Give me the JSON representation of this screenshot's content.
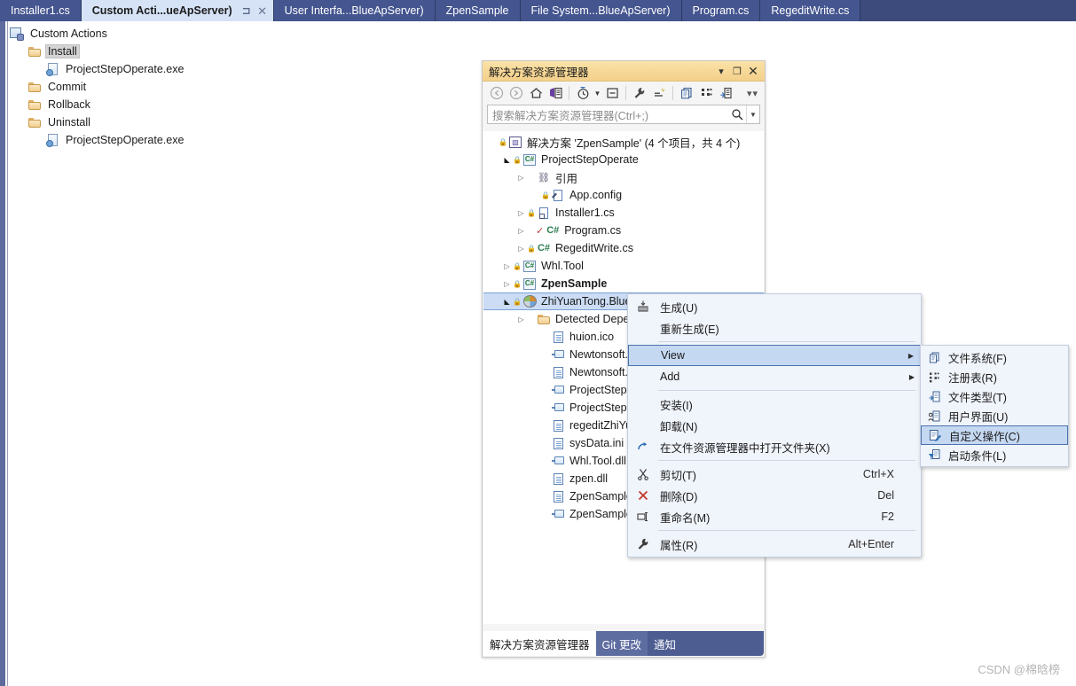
{
  "tabs": [
    {
      "label": "Installer1.cs",
      "active": false
    },
    {
      "label": "Custom Acti...ueApServer)",
      "active": true
    },
    {
      "label": "User Interfa...BlueApServer)",
      "active": false
    },
    {
      "label": "ZpenSample",
      "active": false
    },
    {
      "label": "File System...BlueApServer)",
      "active": false
    },
    {
      "label": "Program.cs",
      "active": false
    },
    {
      "label": "RegeditWrite.cs",
      "active": false
    }
  ],
  "tab_icons": {
    "pin": "pin-icon",
    "close": "close-icon"
  },
  "designer": {
    "tree": [
      {
        "label": "Custom Actions",
        "indent": 0,
        "icon": "custom-actions-icon",
        "selected": false
      },
      {
        "label": "Install",
        "indent": 1,
        "icon": "folder-icon",
        "selected": true
      },
      {
        "label": "ProjectStepOperate.exe",
        "indent": 2,
        "icon": "exe-icon",
        "selected": false
      },
      {
        "label": "Commit",
        "indent": 1,
        "icon": "folder-icon",
        "selected": false
      },
      {
        "label": "Rollback",
        "indent": 1,
        "icon": "folder-icon",
        "selected": false
      },
      {
        "label": "Uninstall",
        "indent": 1,
        "icon": "folder-icon",
        "selected": false
      },
      {
        "label": "ProjectStepOperate.exe",
        "indent": 2,
        "icon": "exe-icon",
        "selected": false
      }
    ]
  },
  "solution_explorer": {
    "title": "解决方案资源管理器",
    "window_buttons": {
      "dropdown": "▾",
      "maximize": "❐",
      "close": "✕"
    },
    "toolbar": [
      {
        "name": "back-icon"
      },
      {
        "name": "forward-icon"
      },
      {
        "name": "home-icon"
      },
      {
        "name": "sync-with-active-document-icon"
      },
      {
        "name": "pending-changes-filter-icon"
      },
      {
        "name": "filter-dropdown-icon"
      },
      {
        "name": "collapse-all-icon"
      },
      {
        "name": "properties-icon"
      },
      {
        "name": "show-all-files-icon"
      },
      {
        "name": "preview-selected-items-icon"
      },
      {
        "name": "view-class-diagram-icon"
      },
      {
        "name": "refresh-icon"
      }
    ],
    "overflow_label": "▾▾",
    "search_placeholder": "搜索解决方案资源管理器(Ctrl+;)",
    "tree": [
      {
        "label": "解决方案 'ZpenSample' (4 个项目，共 4 个)",
        "indent": 0,
        "chevron": "",
        "lock": true,
        "icon": "solution-icon",
        "bold": false,
        "selected": false
      },
      {
        "label": "ProjectStepOperate",
        "indent": 1,
        "chevron": "down",
        "lock": true,
        "icon": "csharp-project-icon",
        "bold": false,
        "selected": false
      },
      {
        "label": "引用",
        "indent": 2,
        "chevron": "right",
        "lock": false,
        "icon": "references-icon",
        "bold": false,
        "selected": false
      },
      {
        "label": "App.config",
        "indent": 3,
        "chevron": "",
        "lock": true,
        "icon": "config-file-icon",
        "bold": false,
        "selected": false
      },
      {
        "label": "Installer1.cs",
        "indent": 2,
        "chevron": "right",
        "lock": true,
        "icon": "installer-class-icon",
        "bold": false,
        "selected": false
      },
      {
        "label": "Program.cs",
        "indent": 2,
        "chevron": "right",
        "lock": false,
        "icon": "csharp-file-checked-icon",
        "bold": false,
        "selected": false
      },
      {
        "label": "RegeditWrite.cs",
        "indent": 2,
        "chevron": "right",
        "lock": true,
        "icon": "csharp-file-icon",
        "bold": false,
        "selected": false
      },
      {
        "label": "Whl.Tool",
        "indent": 1,
        "chevron": "right",
        "lock": true,
        "icon": "csharp-project-icon",
        "bold": false,
        "selected": false
      },
      {
        "label": "ZpenSample",
        "indent": 1,
        "chevron": "right",
        "lock": true,
        "icon": "csharp-project-icon",
        "bold": true,
        "selected": false
      },
      {
        "label": "ZhiYuanTong.BlueApServer",
        "indent": 1,
        "chevron": "down",
        "lock": true,
        "icon": "setup-project-icon",
        "bold": false,
        "selected": true
      },
      {
        "label": "Detected Dependencies",
        "indent": 2,
        "chevron": "right",
        "lock": false,
        "icon": "folder-icon",
        "bold": false,
        "selected": false
      },
      {
        "label": "huion.ico",
        "indent": 3,
        "chevron": "",
        "lock": false,
        "icon": "document-icon",
        "bold": false,
        "selected": false
      },
      {
        "label": "Newtonsoft.Json.dll",
        "indent": 3,
        "chevron": "",
        "lock": false,
        "icon": "assembly-icon",
        "bold": false,
        "selected": false
      },
      {
        "label": "Newtonsoft.Json.xml",
        "indent": 3,
        "chevron": "",
        "lock": false,
        "icon": "document-icon",
        "bold": false,
        "selected": false
      },
      {
        "label": "ProjectStepOperate.exe",
        "indent": 3,
        "chevron": "",
        "lock": false,
        "icon": "assembly-icon",
        "bold": false,
        "selected": false
      },
      {
        "label": "ProjectStepOperate.exe",
        "indent": 3,
        "chevron": "",
        "lock": false,
        "icon": "assembly-icon",
        "bold": false,
        "selected": false
      },
      {
        "label": "regeditZhiYuanTong.reg",
        "indent": 3,
        "chevron": "",
        "lock": false,
        "icon": "document-icon",
        "bold": false,
        "selected": false
      },
      {
        "label": "sysData.ini",
        "indent": 3,
        "chevron": "",
        "lock": false,
        "icon": "document-icon",
        "bold": false,
        "selected": false
      },
      {
        "label": "Whl.Tool.dll",
        "indent": 3,
        "chevron": "",
        "lock": false,
        "icon": "assembly-icon",
        "bold": false,
        "selected": false
      },
      {
        "label": "zpen.dll",
        "indent": 3,
        "chevron": "",
        "lock": false,
        "icon": "document-icon",
        "bold": false,
        "selected": false
      },
      {
        "label": "ZpenSample.exe.config",
        "indent": 3,
        "chevron": "",
        "lock": false,
        "icon": "document-icon",
        "bold": false,
        "selected": false
      },
      {
        "label": "ZpenSample.exe",
        "indent": 3,
        "chevron": "",
        "lock": false,
        "icon": "assembly-icon",
        "bold": false,
        "selected": false
      }
    ],
    "bottom_tabs": [
      {
        "label": "解决方案资源管理器",
        "active": true
      },
      {
        "label": "Git 更改",
        "active": false
      },
      {
        "label": "通知",
        "active": false
      }
    ]
  },
  "context_menu": {
    "items": [
      {
        "type": "item",
        "label": "生成(U)",
        "shortcut": "",
        "icon": "build-icon",
        "arrow": false,
        "highlighted": false
      },
      {
        "type": "item",
        "label": "重新生成(E)",
        "shortcut": "",
        "icon": "",
        "arrow": false,
        "highlighted": false
      },
      {
        "type": "separator"
      },
      {
        "type": "item",
        "label": "View",
        "shortcut": "",
        "icon": "",
        "arrow": true,
        "highlighted": true
      },
      {
        "type": "item",
        "label": "Add",
        "shortcut": "",
        "icon": "",
        "arrow": true,
        "highlighted": false
      },
      {
        "type": "separator"
      },
      {
        "type": "item",
        "label": "安装(I)",
        "shortcut": "",
        "icon": "",
        "arrow": false,
        "highlighted": false
      },
      {
        "type": "item",
        "label": "卸载(N)",
        "shortcut": "",
        "icon": "",
        "arrow": false,
        "highlighted": false
      },
      {
        "type": "item",
        "label": "在文件资源管理器中打开文件夹(X)",
        "shortcut": "",
        "icon": "open-folder-icon",
        "arrow": false,
        "highlighted": false
      },
      {
        "type": "separator"
      },
      {
        "type": "item",
        "label": "剪切(T)",
        "shortcut": "Ctrl+X",
        "icon": "cut-icon",
        "arrow": false,
        "highlighted": false
      },
      {
        "type": "item",
        "label": "删除(D)",
        "shortcut": "Del",
        "icon": "delete-icon",
        "arrow": false,
        "highlighted": false
      },
      {
        "type": "item",
        "label": "重命名(M)",
        "shortcut": "F2",
        "icon": "rename-icon",
        "arrow": false,
        "highlighted": false
      },
      {
        "type": "separator"
      },
      {
        "type": "item",
        "label": "属性(R)",
        "shortcut": "Alt+Enter",
        "icon": "properties-wrench-icon",
        "arrow": false,
        "highlighted": false
      }
    ]
  },
  "submenu": {
    "items": [
      {
        "label": "文件系统(F)",
        "icon": "file-system-icon",
        "highlighted": false
      },
      {
        "label": "注册表(R)",
        "icon": "registry-icon",
        "highlighted": false
      },
      {
        "label": "文件类型(T)",
        "icon": "file-types-icon",
        "highlighted": false
      },
      {
        "label": "用户界面(U)",
        "icon": "user-interface-icon",
        "highlighted": false
      },
      {
        "label": "自定义操作(C)",
        "icon": "custom-actions-icon",
        "highlighted": true
      },
      {
        "label": "启动条件(L)",
        "icon": "launch-conditions-icon",
        "highlighted": false
      }
    ]
  },
  "watermark": "CSDN @棉晗榜",
  "colors": {
    "tabstrip_bg": "#3c4a7c",
    "tab_inactive": "#44558f",
    "tab_active": "#d6e3f7",
    "se_title_bg": "#f3d08a",
    "menu_bg": "#f0f4fb",
    "menu_highlight": "#c5d8f2",
    "tree_selection": "#cbdcf4",
    "bottom_tabs_bg": "#4d5d92"
  }
}
